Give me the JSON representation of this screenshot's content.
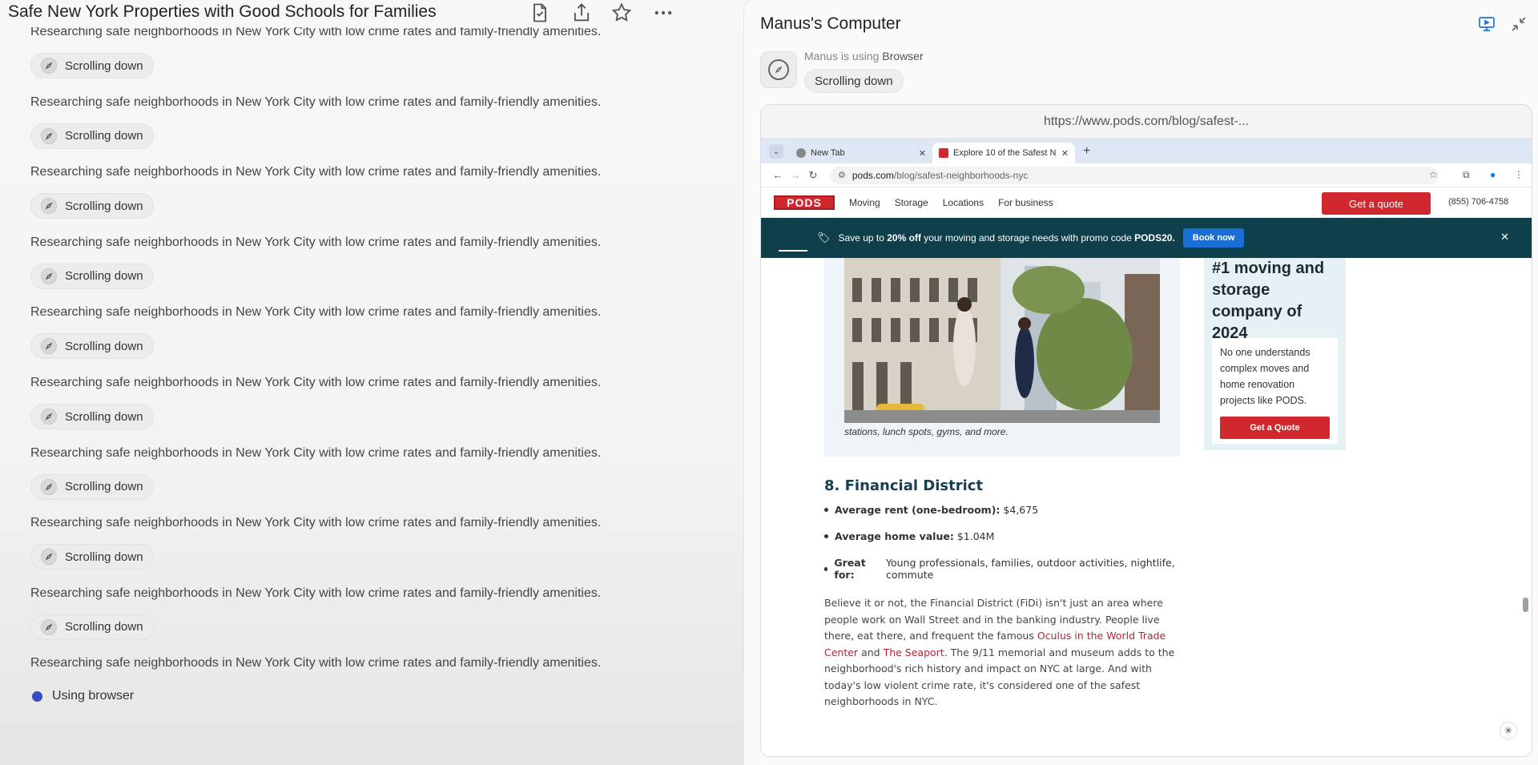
{
  "left": {
    "title": "Safe New York Properties with Good Schools for Families",
    "feed": [
      {
        "text": "Researching safe neighborhoods in New York City with low crime rates and family-friendly amenities.",
        "chip": "Scrolling down"
      },
      {
        "text": "Researching safe neighborhoods in New York City with low crime rates and family-friendly amenities.",
        "chip": "Scrolling down"
      },
      {
        "text": "Researching safe neighborhoods in New York City with low crime rates and family-friendly amenities.",
        "chip": "Scrolling down"
      },
      {
        "text": "Researching safe neighborhoods in New York City with low crime rates and family-friendly amenities.",
        "chip": "Scrolling down"
      },
      {
        "text": "Researching safe neighborhoods in New York City with low crime rates and family-friendly amenities.",
        "chip": "Scrolling down"
      },
      {
        "text": "Researching safe neighborhoods in New York City with low crime rates and family-friendly amenities.",
        "chip": "Scrolling down"
      },
      {
        "text": "Researching safe neighborhoods in New York City with low crime rates and family-friendly amenities.",
        "chip": "Scrolling down"
      },
      {
        "text": "Researching safe neighborhoods in New York City with low crime rates and family-friendly amenities.",
        "chip": "Scrolling down"
      },
      {
        "text": "Researching safe neighborhoods in New York City with low crime rates and family-friendly amenities.",
        "chip": "Scrolling down"
      }
    ],
    "last_text": "Researching safe neighborhoods in New York City with low crime rates and family-friendly amenities.",
    "status": "Using browser"
  },
  "right": {
    "title": "Manus's Computer",
    "agent_prefix": "Manus is using",
    "agent_tool": "Browser",
    "agent_action": "Scrolling down",
    "url_display": "https://www.pods.com/blog/safest-...",
    "tabs": [
      {
        "label": "New Tab"
      },
      {
        "label": "Explore 10 of the Safest N"
      }
    ],
    "address_host": "pods.com",
    "address_path": "/blog/safest-neighborhoods-nyc"
  },
  "site": {
    "logo": "PODS",
    "nav": [
      "Moving",
      "Storage",
      "Locations",
      "For business"
    ],
    "quote_top": "Get a quote",
    "phone": "(855) 706-4758",
    "promo_pre": "Save up to",
    "promo_bold": "20% off",
    "promo_mid": "your moving and storage needs with promo code",
    "promo_code": "PODS20.",
    "promo_button": "Book now",
    "caption": "stations, lunch spots, gyms, and more.",
    "side_heading": "#1 moving and storage company of 2024",
    "side_text": "No one understands complex moves and home renovation projects like PODS.",
    "side_button": "Get a Quote",
    "section_title": "8. Financial District",
    "bullets": [
      {
        "label": "Average rent (one-bedroom):",
        "value": "$4,675"
      },
      {
        "label": "Average home value:",
        "value": "$1.04M"
      },
      {
        "label": "Great for:",
        "value": "Young professionals, families, outdoor activities, nightlife, commute"
      }
    ],
    "para_1": "Believe it or not, the Financial District (FiDi) isn't just an area where people work on Wall Street and in the banking industry. People live there, eat there, and frequent the famous",
    "link_1": "Oculus in the World Trade Center",
    "para_and": "and",
    "link_2": "The Seaport",
    "para_2": ". The 9/11 memorial and museum adds to the neighborhood's rich history and impact on NYC at large. And with today's low violent crime rate, it's considered one of the safest neighborhoods in NYC."
  },
  "colors": {
    "pods_red": "#d0282e",
    "promo_bg": "#103f4c",
    "link_red": "#b3263a",
    "status_dot": "#3b4cc0"
  }
}
